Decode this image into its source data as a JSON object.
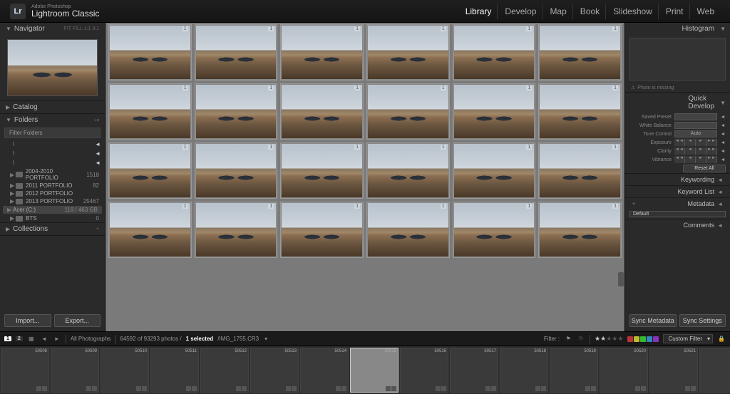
{
  "header": {
    "badge": "Lr",
    "brand_small": "Adobe Photoshop",
    "brand_big": "Lightroom Classic",
    "modules": [
      "Library",
      "Develop",
      "Map",
      "Book",
      "Slideshow",
      "Print",
      "Web"
    ],
    "active_module": "Library"
  },
  "left": {
    "navigator": {
      "title": "Navigator",
      "extras": "FIT  FILL  1:1  3:1"
    },
    "catalog": {
      "title": "Catalog"
    },
    "folders": {
      "title": "Folders",
      "filter_placeholder": "Filter Folders",
      "volumes": [
        {
          "label": "\\",
          "arrow": "◄"
        },
        {
          "label": "\\",
          "arrow": "◄"
        },
        {
          "label": "\\",
          "arrow": "◄"
        }
      ],
      "items": [
        {
          "name": "2004-2010 PORTFOLIO",
          "count": "1518"
        },
        {
          "name": "2011 PORTFOLIO",
          "count": "82"
        },
        {
          "name": "2012 PORTFOLIO",
          "count": ""
        },
        {
          "name": "2013 PORTFOLIO",
          "count": "25467"
        }
      ],
      "drive": {
        "name": "Acer (C:)",
        "meta": "118 / 463 GB"
      },
      "sub": {
        "name": "BTS",
        "count": "0"
      }
    },
    "collections": {
      "title": "Collections"
    },
    "buttons": {
      "import": "Import...",
      "export": "Export..."
    }
  },
  "right": {
    "histogram": {
      "title": "Histogram"
    },
    "histo_msg": "Photo is missing",
    "quick_develop": {
      "title": "Quick Develop",
      "rows": [
        {
          "label": "Saved Preset",
          "type": "select"
        },
        {
          "label": "White Balance",
          "type": "select"
        },
        {
          "label": "Tone Control",
          "type": "btn",
          "btn": "Auto"
        },
        {
          "label": "Exposure",
          "type": "stepper"
        },
        {
          "label": "Clarity",
          "type": "stepper"
        },
        {
          "label": "Vibrance",
          "type": "stepper"
        }
      ],
      "reset": "Reset All"
    },
    "links": [
      "Keywording",
      "Keyword List",
      "Metadata",
      "Comments"
    ],
    "meta_default": "Default",
    "sync": {
      "meta": "Sync Metadata",
      "settings": "Sync Settings"
    }
  },
  "toolbar": {
    "badge1": "1",
    "badge2": "2",
    "breadcrumb": "All Photographs",
    "status": "64592 of 93293 photos /",
    "selected": "1 selected",
    "file": "/IMG_1755.CR3",
    "filter_label": "Filter :",
    "custom": "Custom Filter",
    "colors": [
      "#b33",
      "#bb3",
      "#3b3",
      "#38b",
      "#83b"
    ]
  },
  "filmstrip": {
    "start": 50508,
    "count": 15,
    "selected_index": 7
  },
  "grid": {
    "rows": 4,
    "cols": 6
  }
}
